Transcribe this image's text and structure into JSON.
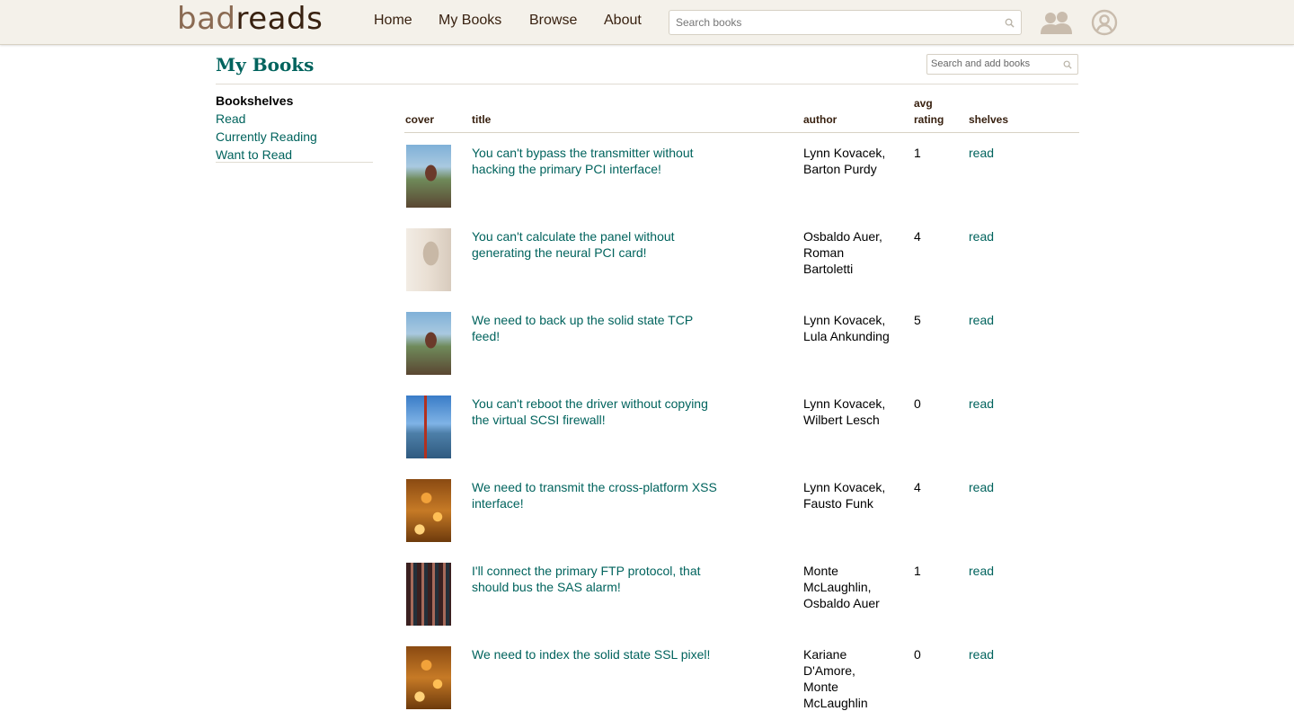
{
  "header": {
    "logo": {
      "part1": "bad",
      "part2": "reads"
    },
    "nav": {
      "home": "Home",
      "my_books": "My Books",
      "browse": "Browse",
      "about": "About"
    },
    "search": {
      "placeholder": "Search books"
    },
    "icons": {
      "friends": "friends-icon",
      "profile": "profile-icon",
      "search": "search-icon"
    }
  },
  "page": {
    "title": "My Books",
    "add_search": {
      "placeholder": "Search and add books"
    }
  },
  "sidebar": {
    "heading": "Bookshelves",
    "shelves": [
      "Read",
      "Currently Reading",
      "Want to Read"
    ]
  },
  "table": {
    "columns": {
      "cover": "cover",
      "title": "title",
      "author": "author",
      "rating": "avg rating",
      "shelves": "shelves"
    },
    "rows": [
      {
        "title": "You can't bypass the transmitter without hacking the primary PCI interface!",
        "author": "Lynn Kovacek, Barton Purdy",
        "rating": "1",
        "shelf": "read",
        "cover": "mountain-bike-rider"
      },
      {
        "title": "You can't calculate the panel without generating the neural PCI card!",
        "author": "Osbaldo Auer, Roman Bartoletti",
        "rating": "4",
        "shelf": "read",
        "cover": "white-cat"
      },
      {
        "title": "We need to back up the solid state TCP feed!",
        "author": "Lynn Kovacek, Lula Ankunding",
        "rating": "5",
        "shelf": "read",
        "cover": "mountain-bike-rider"
      },
      {
        "title": "You can't reboot the driver without copying the virtual SCSI firewall!",
        "author": "Lynn Kovacek, Wilbert Lesch",
        "rating": "0",
        "shelf": "read",
        "cover": "golden-gate-bridge"
      },
      {
        "title": "We need to transmit the cross-platform XSS interface!",
        "author": "Lynn Kovacek, Fausto Funk",
        "rating": "4",
        "shelf": "read",
        "cover": "bokeh-lights"
      },
      {
        "title": "I'll connect the primary FTP protocol, that should bus the SAS alarm!",
        "author": "Monte McLaughlin, Osbaldo Auer",
        "rating": "1",
        "shelf": "read",
        "cover": "bar-bottles"
      },
      {
        "title": "We need to index the solid state SSL pixel!",
        "author": "Kariane D'Amore, Monte McLaughlin",
        "rating": "0",
        "shelf": "read",
        "cover": "bokeh-lights"
      }
    ]
  },
  "colors": {
    "link": "#00635d",
    "header_bg": "#f4f1ea",
    "brand_dark": "#382110",
    "brand_light": "#8a6a52"
  }
}
